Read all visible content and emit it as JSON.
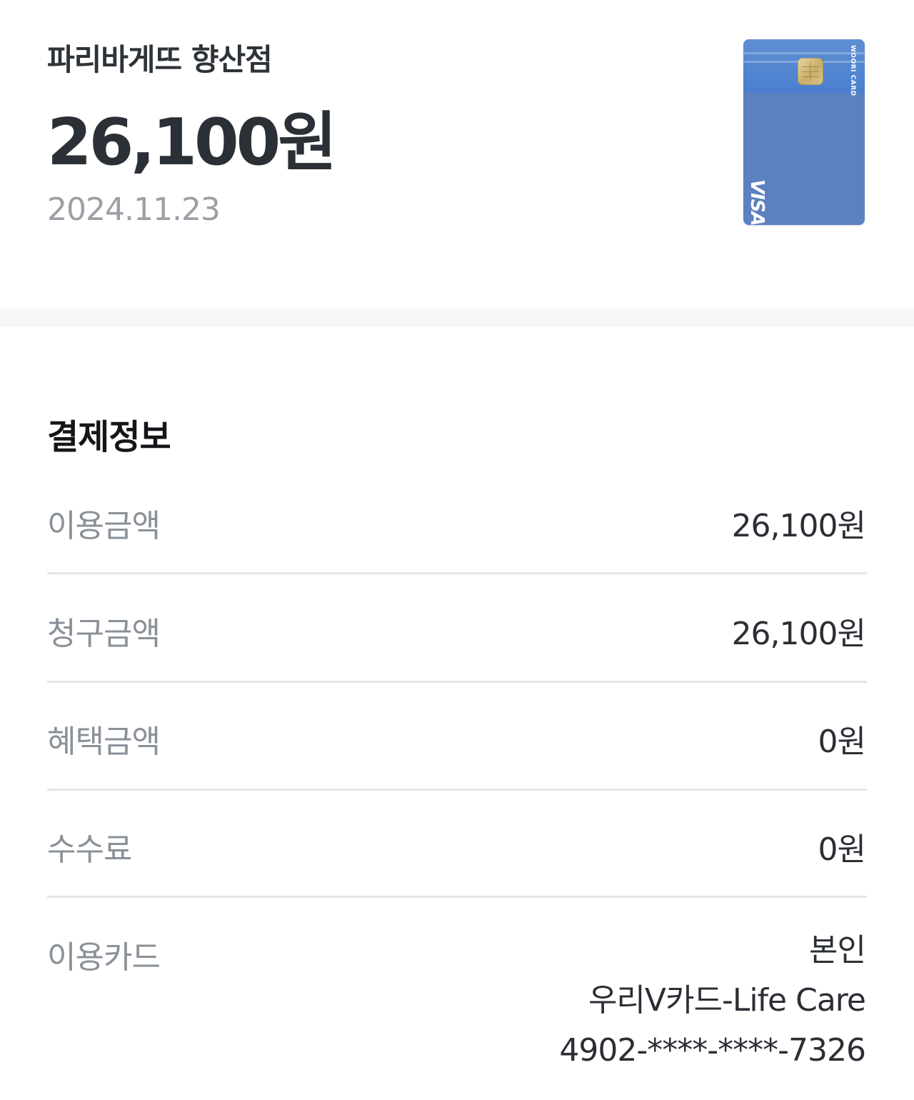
{
  "header": {
    "merchant": "파리바게뜨 향산점",
    "amount": "26,100원",
    "date": "2024.11.23"
  },
  "card_image": {
    "brand_text": "WOORI CARD",
    "network": "VISA",
    "color": "#5b81c1"
  },
  "payment_info": {
    "title": "결제정보",
    "rows": [
      {
        "label": "이용금액",
        "value": "26,100원"
      },
      {
        "label": "청구금액",
        "value": "26,100원"
      },
      {
        "label": "혜택금액",
        "value": "0원"
      },
      {
        "label": "수수료",
        "value": "0원"
      }
    ],
    "card_row": {
      "label": "이용카드",
      "owner": "본인",
      "card_name": "우리V카드-Life Care",
      "card_number": "4902-****-****-7326"
    }
  }
}
